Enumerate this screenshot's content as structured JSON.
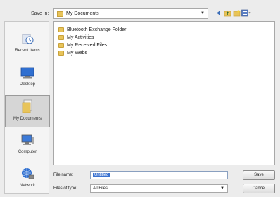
{
  "save_in": {
    "label": "Save in:",
    "value": "My Documents"
  },
  "toolbar_icons": [
    "back-icon",
    "up-folder-icon",
    "new-folder-icon",
    "view-menu-icon"
  ],
  "sidebar": {
    "items": [
      {
        "label": "Recent Items",
        "icon": "recent-items-icon",
        "selected": false
      },
      {
        "label": "Desktop",
        "icon": "desktop-icon",
        "selected": false
      },
      {
        "label": "My Documents",
        "icon": "my-documents-icon",
        "selected": true
      },
      {
        "label": "Computer",
        "icon": "computer-icon",
        "selected": false
      },
      {
        "label": "Network",
        "icon": "network-icon",
        "selected": false
      }
    ]
  },
  "files": [
    {
      "name": "Bluetooth Exchange Folder"
    },
    {
      "name": "My Activities"
    },
    {
      "name": "My Received Files"
    },
    {
      "name": "My Webs"
    }
  ],
  "file_name": {
    "label": "File name:",
    "value": "Untitled"
  },
  "files_of_type": {
    "label": "Files of type:",
    "value": "All Files"
  },
  "buttons": {
    "save": "Save",
    "cancel": "Cancel"
  },
  "colors": {
    "selection": "#3a72d0",
    "folder": "#e8c45a",
    "background": "#ececec"
  }
}
